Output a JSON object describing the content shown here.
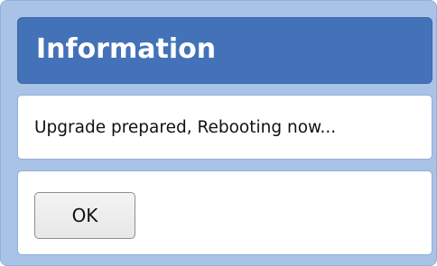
{
  "dialog": {
    "title": "Information",
    "message": "Upgrade prepared, Rebooting now...",
    "ok_label": "OK"
  },
  "colors": {
    "frame": "#a9c3e6",
    "title_bar": "#4372b8",
    "panel_border": "#8fafd9",
    "button_border": "#8f8f8f"
  }
}
